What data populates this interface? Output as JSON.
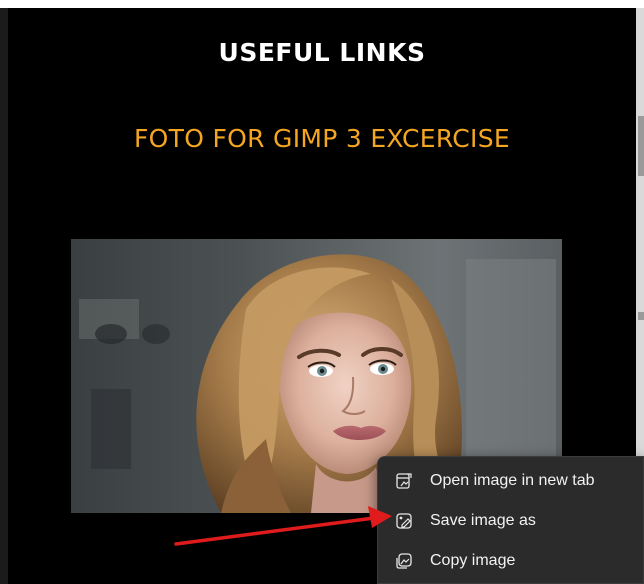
{
  "page": {
    "heading": "USEFUL LINKS",
    "subheading": "FOTO FOR GIMP 3 EXCERCISE"
  },
  "image": {
    "description_icon": "portrait-photo"
  },
  "context_menu": {
    "items": [
      {
        "label": "Open image in new tab",
        "icon": "open-new-tab-icon"
      },
      {
        "label": "Save image as",
        "icon": "save-image-icon"
      },
      {
        "label": "Copy image",
        "icon": "copy-image-icon"
      }
    ]
  },
  "colors": {
    "page_background": "#000000",
    "heading": "#ffffff",
    "subheading": "#f4a623",
    "menu_background": "#2b2b2b",
    "menu_text": "#f2f2f2",
    "annotation_arrow": "#e01b1b"
  }
}
